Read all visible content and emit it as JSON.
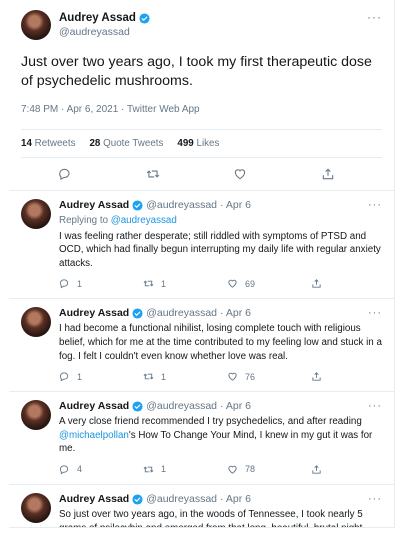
{
  "main_tweet": {
    "name": "Audrey Assad",
    "handle": "@audreyassad",
    "text": "Just over two years ago, I took my first therapeutic dose of psychedelic mushrooms.",
    "timestamp": "7:48 PM · Apr 6, 2021 · Twitter Web App",
    "retweets_count": "14",
    "retweets_label": "Retweets",
    "quotes_count": "28",
    "quotes_label": "Quote Tweets",
    "likes_count": "499",
    "likes_label": "Likes"
  },
  "replies": [
    {
      "name": "Audrey Assad",
      "handle": "@audreyassad",
      "date": "· Apr 6",
      "replying_prefix": "Replying to",
      "replying_to": "@audreyassad",
      "text": "I was feeling rather desperate; still riddled with symptoms of PTSD and OCD, which had finally begun interrupting my daily life with regular anxiety attacks.",
      "replies": "1",
      "retweets": "1",
      "likes": "69"
    },
    {
      "name": "Audrey Assad",
      "handle": "@audreyassad",
      "date": "· Apr 6",
      "text": "I had become a functional nihilist, losing complete touch with religious belief, which for me at the time contributed to my feeling low and stuck in a fog. I felt I couldn't even know whether love was real.",
      "replies": "1",
      "retweets": "1",
      "likes": "76"
    },
    {
      "name": "Audrey Assad",
      "handle": "@audreyassad",
      "date": "· Apr 6",
      "text_before": "A very close friend recommended I try psychedelics, and after reading",
      "mention": "@michaelpollan",
      "text_after": "'s  How To Change Your Mind, I knew in my gut it was for me.",
      "replies": "4",
      "retweets": "1",
      "likes": "78"
    },
    {
      "name": "Audrey Assad",
      "handle": "@audreyassad",
      "date": "· Apr 6",
      "text": "So just over two years ago, in the woods of Tennessee, I took nearly 5 grams of psilocybin and emerged from that long, beautiful, brutal night with hope in my heart and healing in my body."
    }
  ],
  "colors": {
    "accent": "#1b95e0",
    "muted": "#657786",
    "border": "#e6ecf0"
  }
}
